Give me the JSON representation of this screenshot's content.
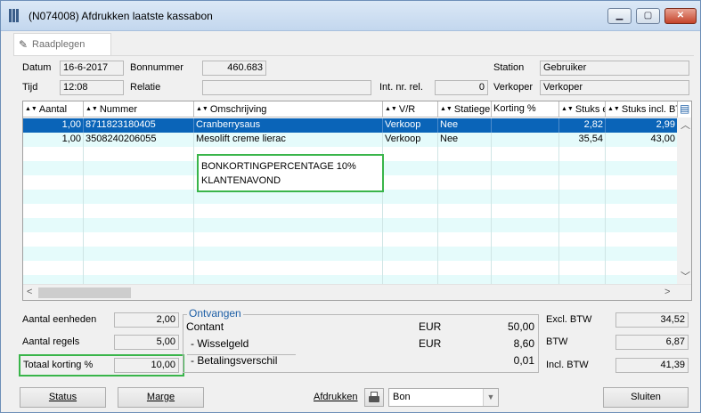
{
  "window": {
    "title": "(N074008) Afdrukken laatste kassabon",
    "controls": {
      "minimize": "▁",
      "maximize": "▢",
      "close": "✕"
    }
  },
  "tab": {
    "label": "Raadplegen",
    "icon": "edit-icon"
  },
  "header": {
    "datum_label": "Datum",
    "datum_value": "16-6-2017",
    "tijd_label": "Tijd",
    "tijd_value": "12:08",
    "bonnummer_label": "Bonnummer",
    "bonnummer_value": "460.683",
    "relatie_label": "Relatie",
    "relatie_value": "",
    "intnr_label": "Int. nr. rel.",
    "intnr_value": "0",
    "station_label": "Station",
    "station_value": "Gebruiker",
    "verkoper_label": "Verkoper",
    "verkoper_value": "Verkoper"
  },
  "grid": {
    "columns": [
      "Aantal",
      "Nummer",
      "Omschrijving",
      "V/R",
      "Statiegeld",
      "Korting %",
      "Stuks e",
      "Stuks incl. BTW"
    ],
    "rows": [
      [
        "1,00",
        "8711823180405",
        "Cranberrysaus",
        "Verkoop",
        "Nee",
        "",
        "2,82",
        "2,99"
      ],
      [
        "1,00",
        "3508240206055",
        "Mesolift creme lierac",
        "Verkoop",
        "Nee",
        "",
        "35,54",
        "43,00"
      ]
    ],
    "note_lines": [
      "BONKORTINGPERCENTAGE 10%",
      "KLANTENAVOND"
    ]
  },
  "totals_left": {
    "aantal_eenheden_label": "Aantal eenheden",
    "aantal_eenheden_value": "2,00",
    "aantal_regels_label": "Aantal regels",
    "aantal_regels_value": "5,00",
    "totaal_korting_label": "Totaal korting %",
    "totaal_korting_value": "10,00"
  },
  "ontvangen": {
    "title": "Ontvangen",
    "rows": [
      {
        "label": "Contant",
        "currency": "EUR",
        "amount": "50,00"
      },
      {
        "label": "- Wisselgeld",
        "currency": "EUR",
        "amount": "8,60"
      },
      {
        "label": "- Betalingsverschil",
        "currency": "",
        "amount": "0,01"
      }
    ]
  },
  "totals_right": {
    "excl_label": "Excl. BTW",
    "excl_value": "34,52",
    "btw_label": "BTW",
    "btw_value": "6,87",
    "incl_label": "Incl. BTW",
    "incl_value": "41,39"
  },
  "footer": {
    "status_label": "Status",
    "marge_label": "Marge",
    "afdrukken_label": "Afdrukken",
    "print_option": "Bon",
    "sluiten_label": "Sluiten"
  },
  "colors": {
    "selection": "#0a64b8",
    "highlight_box": "#39b54a",
    "group_title": "#1d5fa6"
  }
}
